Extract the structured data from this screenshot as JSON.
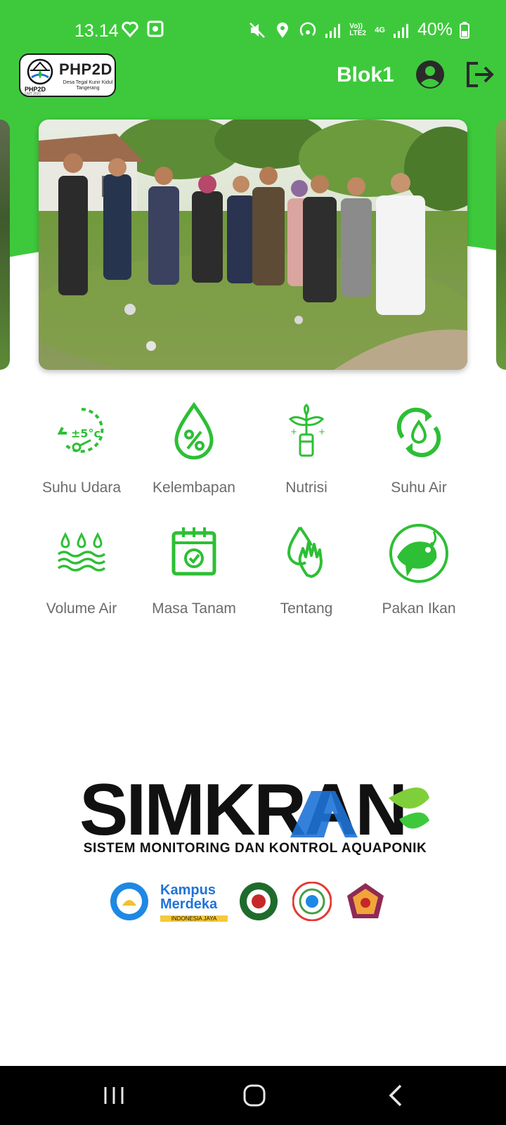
{
  "status_bar": {
    "time": "13.14",
    "battery": "40%",
    "network_left": "Vo)) LTE2",
    "network_right": "4G"
  },
  "header": {
    "logo_title": "PHP2D",
    "logo_subtitle": "Desa Tegal Kunir Kidul Tangerang",
    "logo_small": "PHP2D",
    "logo_small_sub": "UMT 2021",
    "block_name": "Blok1"
  },
  "menu": {
    "items": [
      {
        "label": "Suhu Udara",
        "icon": "thermometer-icon"
      },
      {
        "label": "Kelembapan",
        "icon": "humidity-drop-icon"
      },
      {
        "label": "Nutrisi",
        "icon": "nutrient-plant-icon"
      },
      {
        "label": "Suhu Air",
        "icon": "water-cycle-icon"
      },
      {
        "label": "Volume Air",
        "icon": "water-waves-icon"
      },
      {
        "label": "Masa Tanam",
        "icon": "calendar-check-icon"
      },
      {
        "label": "Tentang",
        "icon": "hand-drop-icon"
      },
      {
        "label": "Pakan Ikan",
        "icon": "fish-icon"
      }
    ]
  },
  "brand": {
    "name": "SIMKRAN",
    "tagline": "SISTEM MONITORING DAN KONTROL AQUAPONIK",
    "partner_text": "Kampus Merdeka",
    "partner_subtext": "INDONESIA JAYA"
  },
  "colors": {
    "primary_green": "#3ec93c",
    "icon_green": "#2dbf35",
    "label_gray": "#6b6b6b",
    "brand_blue": "#1e73d8"
  }
}
